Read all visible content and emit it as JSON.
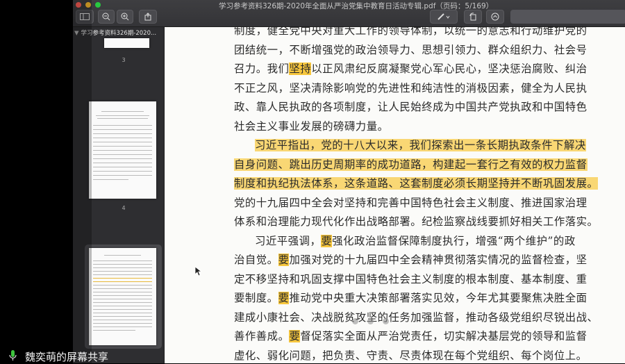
{
  "window": {
    "title": "学习参考资料326期-2020年全面从严治党集中教育日活动专辑.pdf（页码：5/169）",
    "sidebar_heading": "学习参考资料326期-2020...",
    "sidebar_buttons": [
      "sidebar-toggle-icon",
      "zoom-out-icon",
      "zoom-in-icon",
      "share-icon"
    ],
    "right_buttons": [
      "markup-pen-icon",
      "rotate-icon",
      "annotate-icon"
    ]
  },
  "thumbnails": {
    "pages": [
      "3",
      "4"
    ]
  },
  "document": {
    "lines": [
      "制度，健全党中央对重大工作的领导体制，以统一的意志和行动维护党的",
      "团结统一，不断增强党的政治领导力、思想引领力、群众组织力、社会号",
      "召力。我们坚持以正风肃纪反腐凝聚党心军心民心，坚决惩治腐败、纠治",
      "不正之风，坚决清除影响党的先进性和纯洁性的消极因素，健全为人民执",
      "政、靠人民执政的各项制度，让人民始终成为中国共产党执政和中国特色",
      "社会主义事业发展的磅礴力量。",
      "习近平指出，党的十八大以来，我们探索出一条长期执政条件下解决",
      "自身问题、跳出历史周期率的成功道路，构建起一套行之有效的权力监督",
      "制度和执纪执法体系，这条道路、这套制度必须长期坚持并不断巩固发展。",
      "党的十九届四中全会对坚持和完善中国特色社会主义制度、推进国家治理",
      "体系和治理能力现代化作出战略部署。纪检监察战线要抓好相关工作落实。",
      "习近平强调，要强化政治监督保障制度执行，增强“两个维护”的政",
      "治自觉。要加强对党的十九届四中全会精神贯彻落实情况的监督检查，坚",
      "定不移坚持和巩固支撑中国特色社会主义制度的根本制度、基本制度、重",
      "要制度。要推动党中央重大决策部署落实见效，今年尤其要聚焦决胜全面",
      "建成小康社会、决战脱贫攻坚的任务加强监督，推动各级党组织尽锐出战、",
      "善作善成。要督促落实全面从严治党责任，切实解决基层党的领导和监督",
      "虚化、弱化问题，把负责、守责、尽责体现在每个党组织、每个岗位上。"
    ],
    "highlight_words": [
      "坚持",
      "要",
      "要",
      "要",
      "要"
    ]
  },
  "screen_share": {
    "label": "魏奕萌的屏幕共享"
  }
}
